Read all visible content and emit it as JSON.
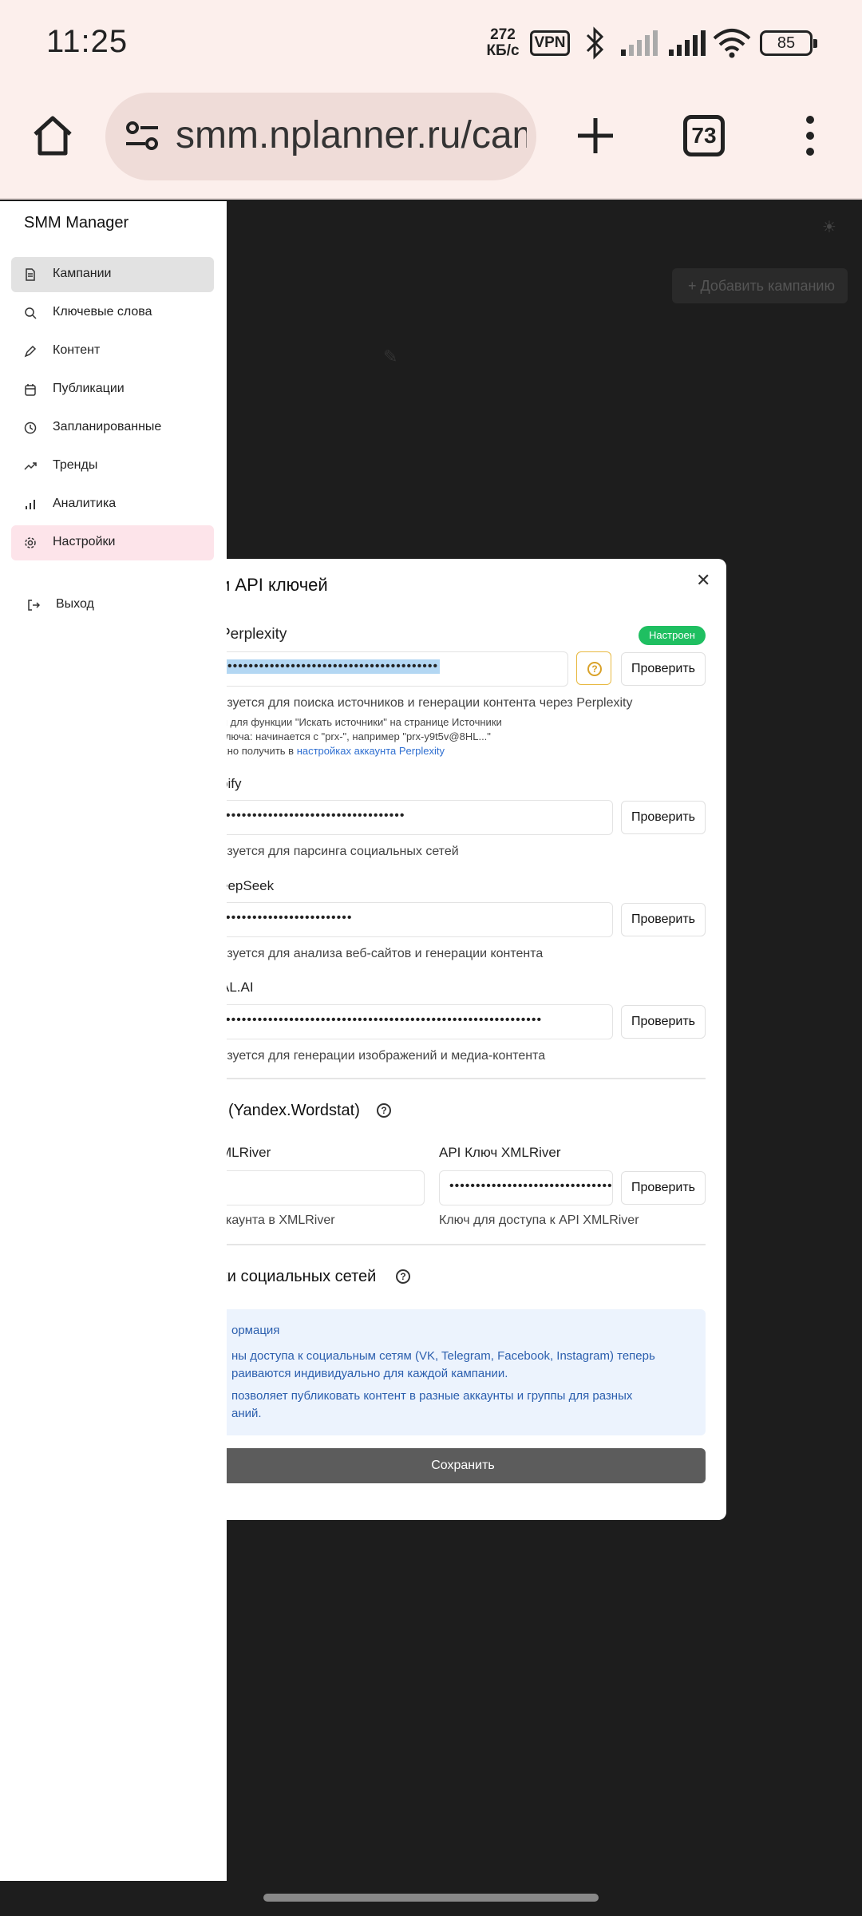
{
  "status_bar": {
    "time": "11:25",
    "net_speed_value": "272",
    "net_speed_unit": "КБ/с",
    "vpn": "VPN",
    "battery": "85"
  },
  "browser": {
    "url": "smm.nplanner.ru/camp",
    "tab_count": "73"
  },
  "page": {
    "add_campaign_label": "+  Добавить кампанию"
  },
  "sidebar": {
    "app_title": "SMM Manager",
    "items": [
      {
        "label": "Кампании",
        "icon": "document-icon"
      },
      {
        "label": "Ключевые слова",
        "icon": "search-icon"
      },
      {
        "label": "Контент",
        "icon": "pen-icon"
      },
      {
        "label": "Публикации",
        "icon": "calendar-icon"
      },
      {
        "label": "Запланированные",
        "icon": "clock-icon"
      },
      {
        "label": "Тренды",
        "icon": "trend-icon"
      },
      {
        "label": "Аналитика",
        "icon": "bar-chart-icon"
      },
      {
        "label": "Настройки",
        "icon": "gear-icon"
      }
    ],
    "logout": "Выход"
  },
  "modal": {
    "title": "и API ключей",
    "check_label": "Проверить",
    "perplexity": {
      "label": "Perplexity",
      "status": "Настроен",
      "value": "••••••••••••••••••••••••••••••••••••••••",
      "hint": "ьзуется для поиска источников и генерации контента через Perplexity",
      "note1": "м для функции \"Искать источники\" на странице Источники",
      "note2": "ключа: начинается с \"prx-\", например \"prx-y9t5v@8HL...\"",
      "note3_prefix": "жно получить в ",
      "note3_link": "настройках аккаунта Perplexity"
    },
    "apify": {
      "label": "pify",
      "value": "••••••••••••••••••••••••••••••••••",
      "hint": "ьзуется для парсинга социальных сетей"
    },
    "deepseek": {
      "label": "eepSeek",
      "value": "••••••••••••••••••••••••",
      "hint": "ьзуется для анализа веб-сайтов и генерации контента"
    },
    "falai": {
      "label": "AL.AI",
      "value": "••••••••••••••••••••••••••••••••••••••••••••••••••••••••••••",
      "hint": "ьзуется для генерации изображений и медиа-контента"
    },
    "wordstat": {
      "section_title": "(Yandex.Wordstat)",
      "user_label": "MLRiver",
      "user_value": "",
      "user_hint": "ккаунта в XMLRiver",
      "key_label": "API Ключ XMLRiver",
      "key_value": "••••••••••••••••••••••••••••••••••••",
      "key_hint": "Ключ для доступа к API XMLRiver"
    },
    "social": {
      "section_title": "ки социальных сетей",
      "info_title": "ормация",
      "info_line1": "ны доступа к социальным сетям (VK, Telegram, Facebook, Instagram) теперь",
      "info_line2": "раиваются индивидуально для каждой кампании.",
      "info_line3": "позволяет публиковать контент в разные аккаунты и группы для разных",
      "info_line4": "аний."
    },
    "save_label": "Сохранить"
  }
}
